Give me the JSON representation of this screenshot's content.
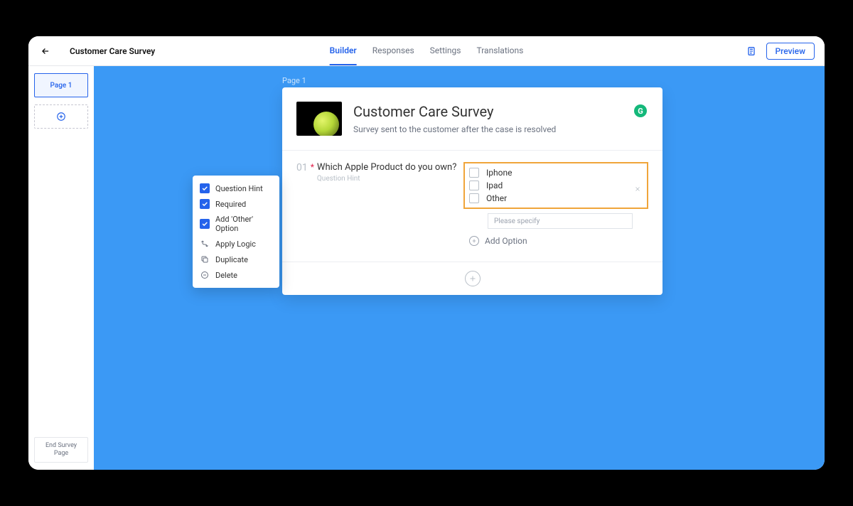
{
  "header": {
    "title": "Customer Care Survey",
    "tabs": {
      "builder": "Builder",
      "responses": "Responses",
      "settings": "Settings",
      "translations": "Translations"
    },
    "preview_label": "Preview"
  },
  "sidebar": {
    "page_thumb_label": "Page 1",
    "end_page_label": "End Survey Page"
  },
  "canvas": {
    "page_label": "Page 1"
  },
  "context_menu": {
    "question_hint": "Question Hint",
    "required": "Required",
    "add_other": "Add 'Other' Option",
    "apply_logic": "Apply Logic",
    "duplicate": "Duplicate",
    "delete": "Delete"
  },
  "card": {
    "title": "Customer Care Survey",
    "subtitle": "Survey sent to the customer after the case is resolved",
    "badge": "G"
  },
  "question": {
    "number": "01",
    "text": "Which Apple Product do you own?",
    "hint_label": "Question Hint",
    "options": {
      "opt1": "Iphone",
      "opt2": "Ipad",
      "opt3": "Other"
    },
    "specify_placeholder": "Please specify",
    "add_option_label": "Add Option"
  }
}
